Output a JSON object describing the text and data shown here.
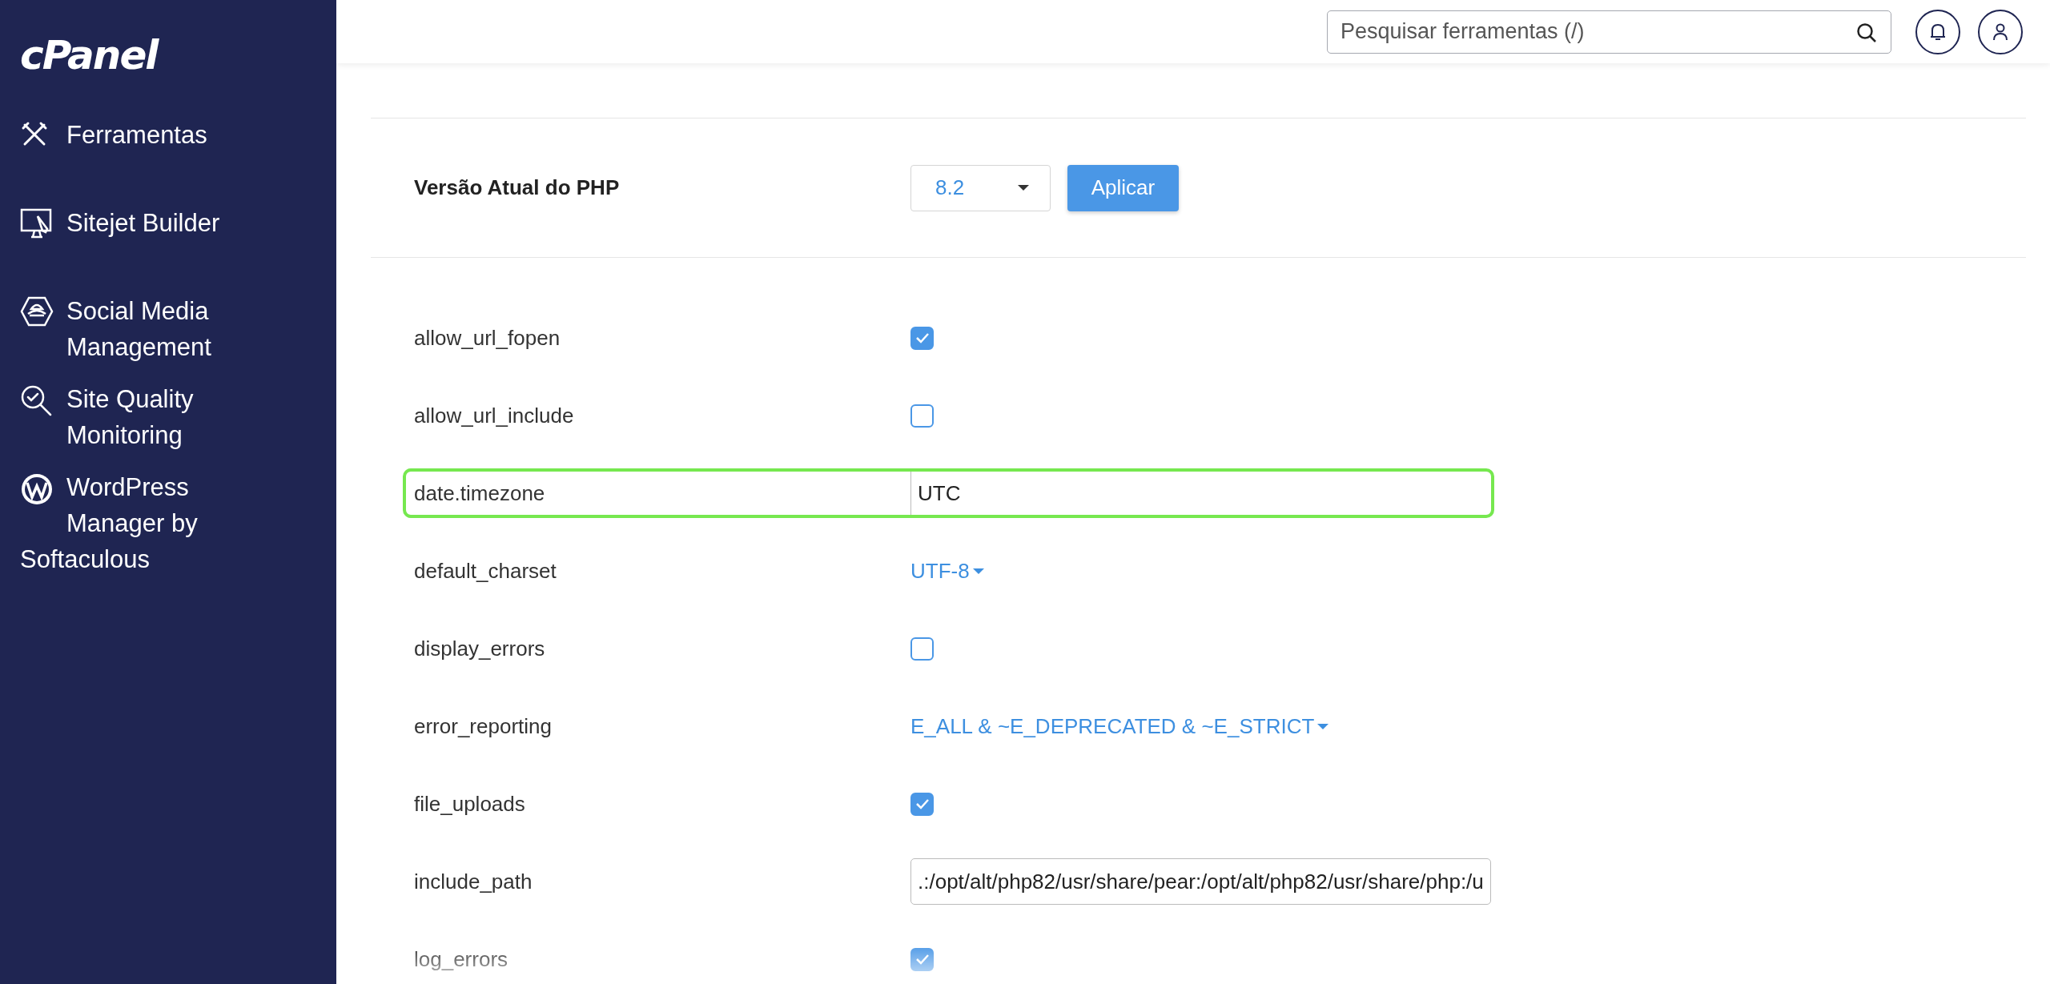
{
  "sidebar": {
    "logo": "cPanel",
    "items": [
      {
        "label": "Ferramentas"
      },
      {
        "label": "Sitejet Builder"
      },
      {
        "label": "Social Media Management"
      },
      {
        "label": "Site Quality Monitoring"
      },
      {
        "label": "WordPress Manager by Softaculous"
      }
    ]
  },
  "header": {
    "search": {
      "placeholder": "Pesquisar ferramentas (/)"
    }
  },
  "php_version": {
    "label": "Versão Atual do PHP",
    "value": "8.2",
    "button": "Aplicar"
  },
  "directives": [
    {
      "name": "allow_url_fopen",
      "kind": "checkbox",
      "checked": true,
      "highlighted": false
    },
    {
      "name": "allow_url_include",
      "kind": "checkbox",
      "checked": false,
      "highlighted": false
    },
    {
      "name": "date.timezone",
      "kind": "text",
      "value": "UTC",
      "highlighted": true
    },
    {
      "name": "default_charset",
      "kind": "dropdown",
      "value": "UTF-8",
      "highlighted": false
    },
    {
      "name": "display_errors",
      "kind": "checkbox",
      "checked": false,
      "highlighted": false
    },
    {
      "name": "error_reporting",
      "kind": "dropdown",
      "value": "E_ALL & ~E_DEPRECATED & ~E_STRICT",
      "highlighted": false
    },
    {
      "name": "file_uploads",
      "kind": "checkbox",
      "checked": true,
      "highlighted": false
    },
    {
      "name": "include_path",
      "kind": "text",
      "value": ".:/opt/alt/php82/usr/share/pear:/opt/alt/php82/usr/share/php:/u",
      "highlighted": false
    },
    {
      "name": "log_errors",
      "kind": "checkbox",
      "checked": true,
      "highlighted": false
    }
  ]
}
